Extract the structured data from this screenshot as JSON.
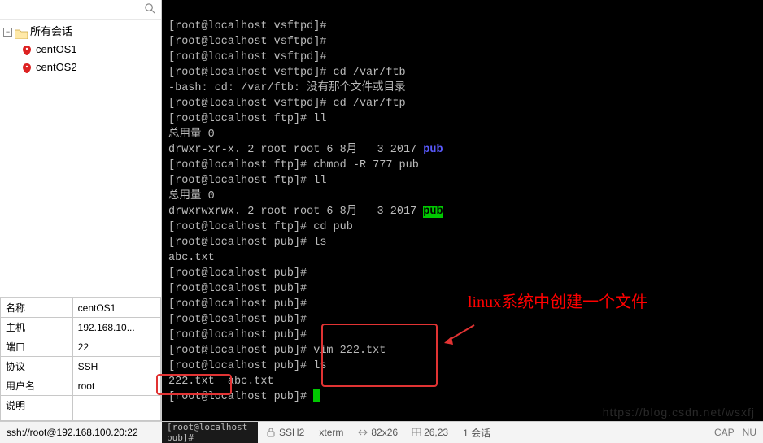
{
  "sidebar": {
    "root_label": "所有会话",
    "sessions": [
      {
        "name": "centOS1"
      },
      {
        "name": "centOS2"
      }
    ]
  },
  "props": {
    "rows": [
      {
        "label": "名称",
        "value": "centOS1"
      },
      {
        "label": "主机",
        "value": "192.168.10..."
      },
      {
        "label": "端口",
        "value": "22"
      },
      {
        "label": "协议",
        "value": "SSH"
      },
      {
        "label": "用户名",
        "value": "root"
      },
      {
        "label": "说明",
        "value": ""
      }
    ]
  },
  "terminal": {
    "lines": [
      "[root@localhost vsftpd]#",
      "[root@localhost vsftpd]#",
      "[root@localhost vsftpd]#",
      "[root@localhost vsftpd]# cd /var/ftb",
      "-bash: cd: /var/ftb: 没有那个文件或目录",
      "[root@localhost vsftpd]# cd /var/ftp",
      "[root@localhost ftp]# ll",
      "总用量 0",
      "drwxr-xr-x. 2 root root 6 8月   3 2017 ",
      "[root@localhost ftp]# chmod -R 777 pub",
      "[root@localhost ftp]# ll",
      "总用量 0",
      "drwxrwxrwx. 2 root root 6 8月   3 2017 ",
      "[root@localhost ftp]# cd pub",
      "[root@localhost pub]# ls",
      "abc.txt",
      "[root@localhost pub]#",
      "[root@localhost pub]#",
      "[root@localhost pub]#",
      "[root@localhost pub]#",
      "[root@localhost pub]#",
      "[root@localhost pub]# vim 222.txt",
      "[root@localhost pub]# ls",
      "222.txt  abc.txt",
      "[root@localhost pub]# "
    ],
    "pub1": "pub",
    "pub2": "pub"
  },
  "annotation": "linux系统中创建一个文件",
  "status": {
    "connection": "ssh://root@192.168.100.20:22",
    "dark_strip": "[root@localhost pub]#",
    "proto": "SSH2",
    "term": "xterm",
    "size": "82x26",
    "cursor": "26,23",
    "sessions": "1 会话",
    "cap": "CAP",
    "num": "NU"
  },
  "watermark": "https://blog.csdn.net/wsxfj"
}
